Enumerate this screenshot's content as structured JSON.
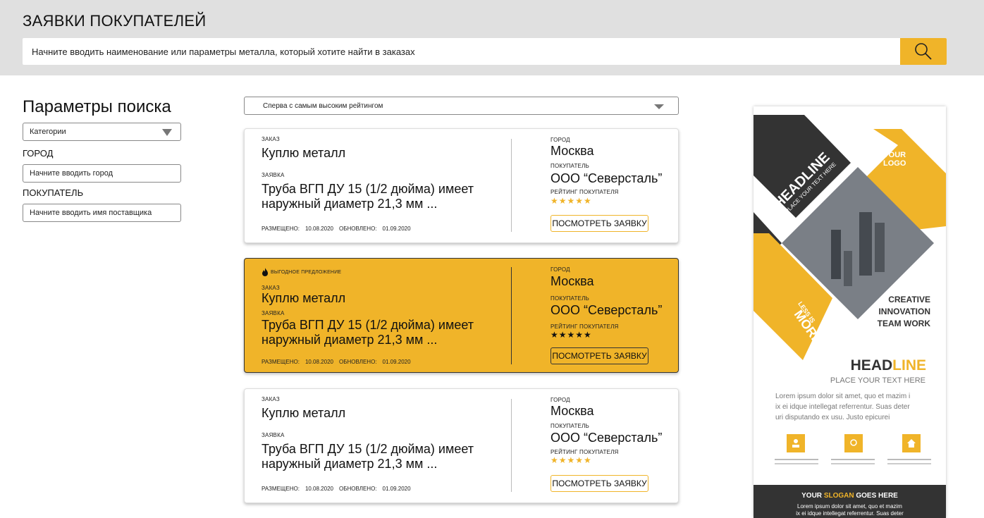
{
  "header": {
    "title": "ЗАЯВКИ ПОКУПАТЕЛЕЙ",
    "search_placeholder": "Начните вводить наименование или параметры металла, который хотите найти в заказах"
  },
  "sidebar": {
    "title": "Параметры поиска",
    "category_label": "Категории",
    "city_label": "ГОРОД",
    "city_placeholder": "Начните вводить город",
    "buyer_label": "ПОКУПАТЕЛЬ",
    "buyer_placeholder": "Начните вводить имя поставщика"
  },
  "sort": {
    "selected": "Сперва с самым высоким рейтингом"
  },
  "labels": {
    "order": "ЗАКАЗ",
    "request": "ЗАЯВКА",
    "placed": "РАЗМЕЩЕНО:",
    "updated": "ОБНОВЛЕНО:",
    "city": "ГОРОД",
    "buyer": "ПОКУПАТЕЛЬ",
    "rating": "РЕЙТИНГ ПОКУПАТЕЛЯ",
    "view_button": "ПОСМОТРЕТЬ ЗАЯВКУ",
    "promo": "ВЫГОДНОЕ ПРЕДЛОЖЕНИЕ"
  },
  "cards": [
    {
      "title": "Куплю металл",
      "desc_line1": "Труба ВГП ДУ 15 (1/2 дюйма) имеет",
      "desc_line2": "наружный диаметр 21,3 мм ...",
      "placed_date": "10.08.2020",
      "updated_date": "01.09.2020",
      "city": "Москва",
      "buyer": "ООО “Северсталь”",
      "stars": "★★★★★",
      "rating": 5
    },
    {
      "title": "Куплю металл",
      "desc_line1": "Труба ВГП ДУ 15 (1/2 дюйма) имеет",
      "desc_line2": "наружный диаметр 21,3 мм ...",
      "placed_date": "10.08.2020",
      "updated_date": "01.09.2020",
      "city": "Москва",
      "buyer": "ООО “Северсталь”",
      "stars": "★★★★★",
      "rating": 5
    },
    {
      "title": "Куплю металл",
      "desc_line1": "Труба ВГП ДУ 15 (1/2 дюйма) имеет",
      "desc_line2": "наружный диаметр 21,3 мм ...",
      "placed_date": "10.08.2020",
      "updated_date": "01.09.2020",
      "city": "Москва",
      "buyer": "ООО “Северсталь”",
      "stars": "★★★★★",
      "rating": 5
    }
  ],
  "ad": {
    "headline_diag": "HEADLINE",
    "subline_diag": "PLACE YOUR TEXT HERE",
    "logo_line1": "YOUR",
    "logo_line2": "LOGO",
    "less_is": "LESS IS",
    "more": "MORE",
    "creative_1": "CREATIVE",
    "creative_2": "INNOVATION",
    "creative_3": "TEAM WORK",
    "head_dark": "HEAD",
    "head_yellow": "LINE",
    "place_text": "PLACE YOUR TEXT HERE",
    "lorem_1": "Lorem ipsum dolor sit amet, quo et mazim i",
    "lorem_2": "ix ei idque intellegat referrentur. Suas deter",
    "lorem_3": "uri disputando ex usu. Justo epicurei",
    "slogan_your": "YOUR ",
    "slogan_word": "SLOGAN",
    "slogan_rest": " GOES HERE",
    "footer_1": "Lorem ipsum dolor sit amet, quo et mazim",
    "footer_2": "ix ei idque intellegat referrentur. Suas deter",
    "colors": {
      "yellow": "#f0b429",
      "dark": "#333333"
    }
  }
}
